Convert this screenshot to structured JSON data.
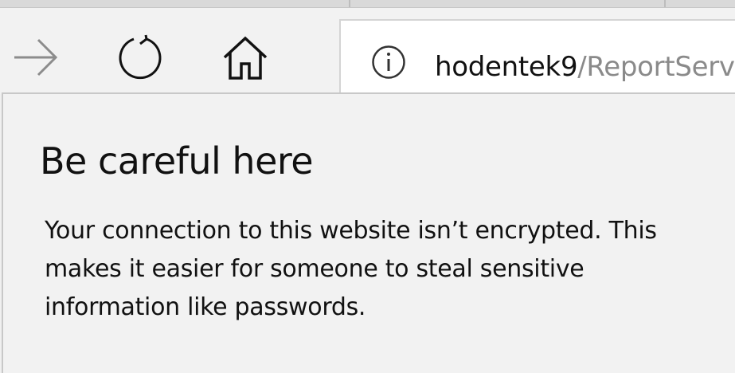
{
  "toolbar": {
    "forward_icon": "arrow-right-icon",
    "refresh_icon": "refresh-icon",
    "home_icon": "home-icon"
  },
  "address_bar": {
    "info_icon": "info-icon",
    "host": "hodentek9",
    "path": "/ReportServ"
  },
  "flyout": {
    "title": "Be careful here",
    "body_lines": [
      "Your connection to this website isn’t encrypted. This",
      "makes it easier for someone to steal sensitive",
      "information like passwords."
    ]
  }
}
